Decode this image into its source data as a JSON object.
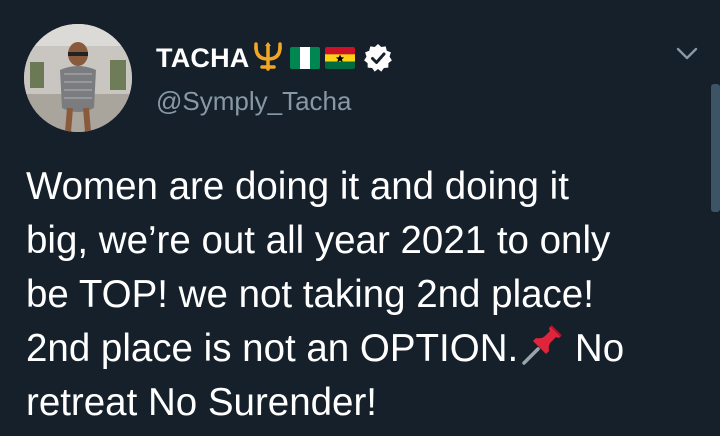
{
  "tweet": {
    "display_name": "TACHA",
    "handle": "@Symply_Tacha",
    "text_part1": "Women are doing it and doing it\nbig, we’re out all year 2021 to only\nbe TOP! we not taking 2nd place!\n2nd place is not an OPTION.",
    "text_part2": " No\nretreat No Surender!",
    "name_emojis": [
      "trident-icon",
      "nigeria-flag-icon",
      "ghana-flag-icon"
    ],
    "inline_emoji": "pushpin-icon"
  },
  "colors": {
    "background": "#15202b",
    "text": "#ffffff",
    "secondary_text": "#8899a6",
    "trident": "#f2a623"
  }
}
